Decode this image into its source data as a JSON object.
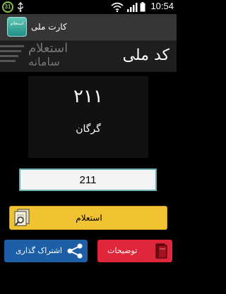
{
  "status_bar": {
    "badge": "31",
    "time": "10:54"
  },
  "action_bar": {
    "app_icon_text": "استعلام",
    "title": "کارت ملی"
  },
  "header": {
    "title": "کد ملی",
    "watermark_line1": "استعلام",
    "watermark_line2": "سامانه"
  },
  "result": {
    "code": "۲۱۱",
    "city": "گرگان"
  },
  "input": {
    "value": "211"
  },
  "buttons": {
    "inquiry": "استعلام",
    "share": "اشتراک گذاری",
    "description": "توضیحات"
  },
  "colors": {
    "inquiry_button": "#f1c232",
    "share_button": "#1d5fa6",
    "description_button": "#e0263a",
    "input_border": "#6aaeae"
  }
}
